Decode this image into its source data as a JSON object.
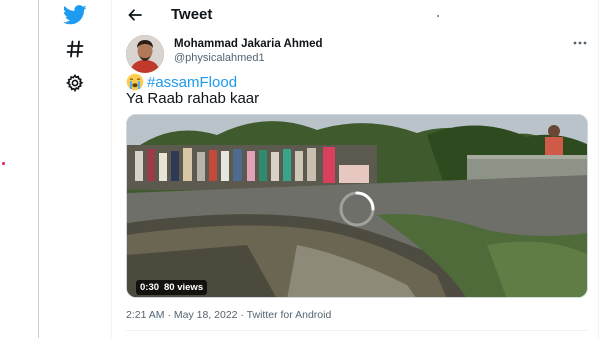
{
  "nav": {
    "icons": [
      "twitter-bird-icon",
      "hashtag-icon",
      "gear-icon"
    ]
  },
  "header": {
    "back_icon": "arrow-left-icon",
    "title": "Tweet"
  },
  "tweet": {
    "author_name": "Mohammad Jakaria Ahmed",
    "author_handle": "@physicalahmed1",
    "more_icon": "more-horizontal-icon",
    "emoji": "crying-face-emoji",
    "hashtag": "#assamFlood",
    "text": "Ya Raab rahab kaar",
    "video": {
      "duration": "0:30",
      "views": "80 views"
    },
    "time": "2:21 AM",
    "date": "May 18, 2022",
    "separator": "·",
    "source": "Twitter for Android"
  },
  "colors": {
    "accent": "#1d9bf0",
    "text": "#0f1419",
    "muted": "#536471"
  }
}
